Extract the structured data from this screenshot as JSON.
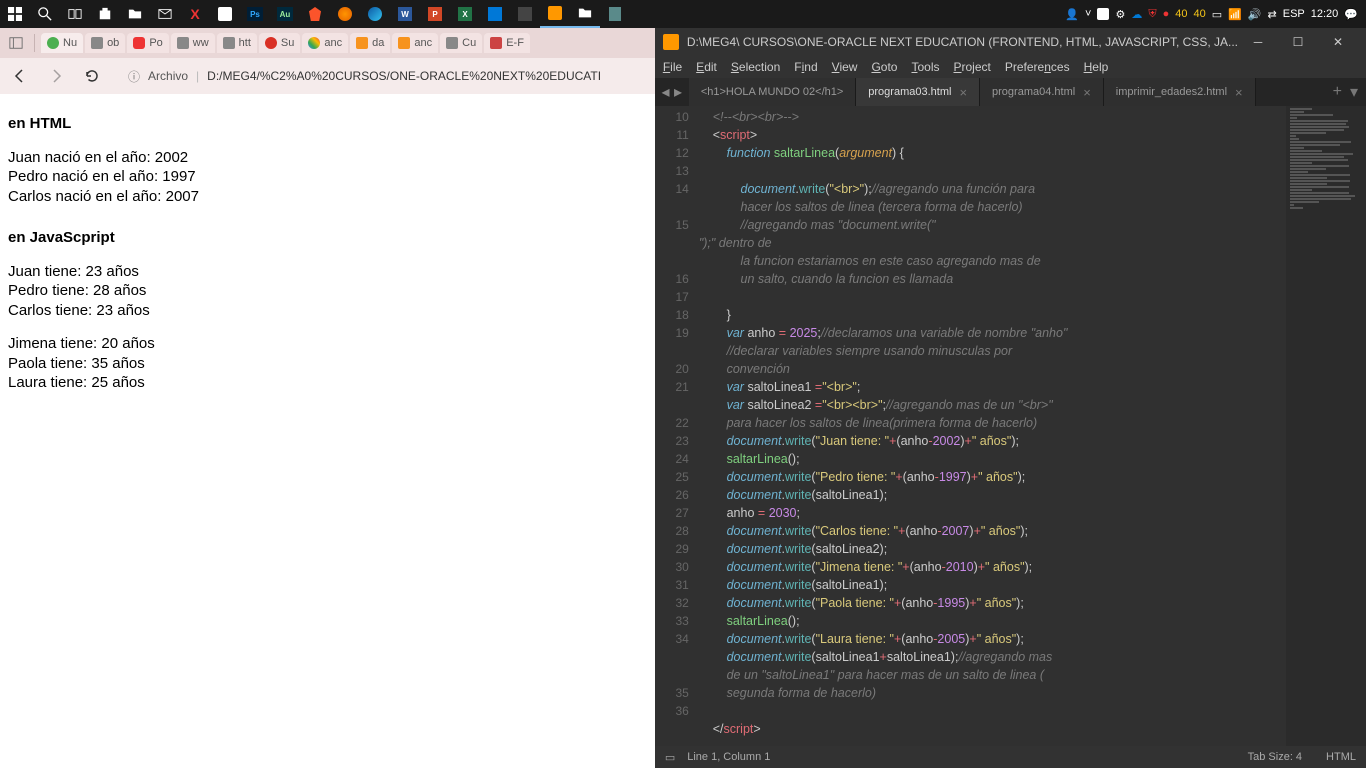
{
  "taskbar": {
    "time": "12:20",
    "lang": "ESP",
    "num1": "40",
    "num2": "40"
  },
  "browser": {
    "tabs": [
      {
        "label": "Nu"
      },
      {
        "label": "ob"
      },
      {
        "label": "Po"
      },
      {
        "label": "ww"
      },
      {
        "label": "htt"
      },
      {
        "label": "Su"
      },
      {
        "label": "anc"
      },
      {
        "label": "da"
      },
      {
        "label": "anc"
      },
      {
        "label": "Cu"
      },
      {
        "label": "E-F"
      }
    ],
    "addr_label": "Archivo",
    "addr_path": "D:/MEG4/%C2%A0%20CURSOS/ONE-ORACLE%20NEXT%20EDUCATI",
    "content": {
      "h1": "en HTML",
      "l1": "Juan nació en el año: 2002",
      "l2": "Pedro nació en el año: 1997",
      "l3": "Carlos nació en el año: 2007",
      "h2": "en JavaScpript",
      "l4": "Juan tiene: 23 años",
      "l5": "Pedro tiene: 28 años",
      "l6": "Carlos tiene: 23 años",
      "l7": "Jimena tiene: 20 años",
      "l8": "Paola tiene: 35 años",
      "l9": "Laura tiene: 25 años"
    }
  },
  "sublime": {
    "title": "D:\\MEG4\\  CURSOS\\ONE-ORACLE NEXT EDUCATION (FRONTEND, HTML, JAVASCRIPT, CSS, JA...",
    "menus": [
      "File",
      "Edit",
      "Selection",
      "Find",
      "View",
      "Goto",
      "Tools",
      "Project",
      "Preferences",
      "Help"
    ],
    "tabs": [
      {
        "label": "<h1>HOLA MUNDO 02</h1>",
        "active": false
      },
      {
        "label": "programa03.html",
        "active": true
      },
      {
        "label": "programa04.html",
        "active": false
      },
      {
        "label": "imprimir_edades2.html",
        "active": false
      }
    ],
    "gutter": [
      "10",
      "11",
      "12",
      "13",
      "14",
      "",
      "15",
      "",
      "",
      "16",
      "17",
      "18",
      "19",
      "",
      "20",
      "21",
      "",
      "22",
      "23",
      "24",
      "25",
      "26",
      "27",
      "28",
      "29",
      "30",
      "31",
      "32",
      "33",
      "34",
      "",
      "",
      "35",
      "36"
    ],
    "status_left": "Line 1, Column 1",
    "status_tab": "Tab Size: 4",
    "status_lang": "HTML",
    "code": {
      "l10": "<!--<br><br>-->",
      "fn_name": "saltarLinea",
      "fn_arg": "argument",
      "cmt14a": "//agregando una función para",
      "cmt14b": "hacer los saltos de linea (tercera forma de hacerlo)",
      "cmt15a": "//agregando mas \"document.write(\"<br>\");\" dentro de",
      "cmt15b": "la funcion estariamos en este caso agregando mas de",
      "cmt15c": "un salto, cuando la funcion es llamada",
      "anho1": "2025",
      "cmt18": "//declaramos una variable de nombre \"anho\"",
      "cmt19a": "//declarar variables siempre usando minusculas por",
      "cmt19b": "convención",
      "sl1": "\"<br>\"",
      "sl2": "\"<br><br>\"",
      "cmt21a": "//agregando mas de un \"<br>\"",
      "cmt21b": "para hacer los saltos de linea(primera forma de hacerlo)",
      "s22a": "\"Juan tiene: \"",
      "n22": "2002",
      "s22b": "\" años\"",
      "s24a": "\"Pedro tiene: \"",
      "n24": "1997",
      "s24b": "\" años\"",
      "anho2": "2030",
      "s27a": "\"Carlos tiene: \"",
      "n27": "2007",
      "s27b": "\" años\"",
      "s29a": "\"Jimena tiene: \"",
      "n29": "2010",
      "s29b": "\" años\"",
      "s31a": "\"Paola tiene: \"",
      "n31": "1995",
      "s31b": "\" años\"",
      "s33a": "\"Laura tiene: \"",
      "n33": "2005",
      "s33b": "\" años\"",
      "cmt34a": "//agregando mas",
      "cmt34b": "de un \"saltoLinea1\" para hacer mas de un salto de linea (",
      "cmt34c": "segunda forma de hacerlo)"
    }
  }
}
